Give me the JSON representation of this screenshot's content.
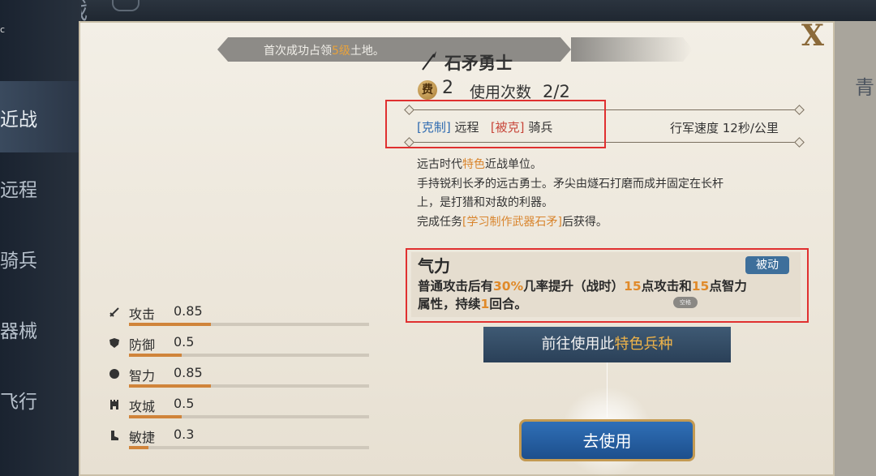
{
  "topbar": {
    "title": "近战"
  },
  "corner_mark": "c",
  "nav": {
    "items": [
      "近战",
      "远程",
      "骑兵",
      "器械",
      "飞行"
    ],
    "active": 0
  },
  "right_char": "青",
  "close": {
    "label": "X"
  },
  "banner": {
    "prefix": "首次成功占领",
    "highlight": "5级",
    "suffix": "土地。"
  },
  "unit": {
    "name": "石矛勇士",
    "cost_icon": "费",
    "cost": "2",
    "uses_label": "使用次数",
    "uses_value": "2/2",
    "counter_tag": "[克制]",
    "counter_target": "远程",
    "countered_tag": "[被克]",
    "countered_target": "骑兵",
    "march_speed": "行军速度  12秒/公里"
  },
  "description": {
    "line1_a": "远古时代",
    "line1_hl": "特色",
    "line1_b": "近战单位。",
    "line2": "手持锐利长矛的远古勇士。矛尖由燧石打磨而成并固定在长杆",
    "line3": "上，是打猎和对敌的利器。",
    "line4_a": "完成任务",
    "line4_hl": "[学习制作武器石矛]",
    "line4_b": "后获得。"
  },
  "skill": {
    "title": "气力",
    "type": "被动",
    "d1": "普通攻击后有",
    "d2": "30%",
    "d3": "几率提升（战时）",
    "d4": "15",
    "d5": "点攻击和",
    "d6": "15",
    "d7": "点智力",
    "d8": "属性，持续",
    "d9": "1",
    "d10": "回合。",
    "chip": "空格"
  },
  "goto_button": {
    "a": "前往使用此",
    "hl": "特色兵种"
  },
  "use_button": {
    "label": "去使用"
  },
  "stats": [
    {
      "label": "攻击",
      "value": "0.85",
      "fill": 0.34,
      "icon": "sword-icon"
    },
    {
      "label": "防御",
      "value": "0.5",
      "fill": 0.22,
      "icon": "shield-icon"
    },
    {
      "label": "智力",
      "value": "0.85",
      "fill": 0.34,
      "icon": "brain-icon"
    },
    {
      "label": "攻城",
      "value": "0.5",
      "fill": 0.22,
      "icon": "tower-icon"
    },
    {
      "label": "敏捷",
      "value": "0.3",
      "fill": 0.08,
      "icon": "boot-icon"
    }
  ],
  "colors": {
    "accent_orange": "#d9852e",
    "tag_blue": "#2f6bb0",
    "tag_red": "#c7463a",
    "button_blue": "#1d4f8c"
  }
}
